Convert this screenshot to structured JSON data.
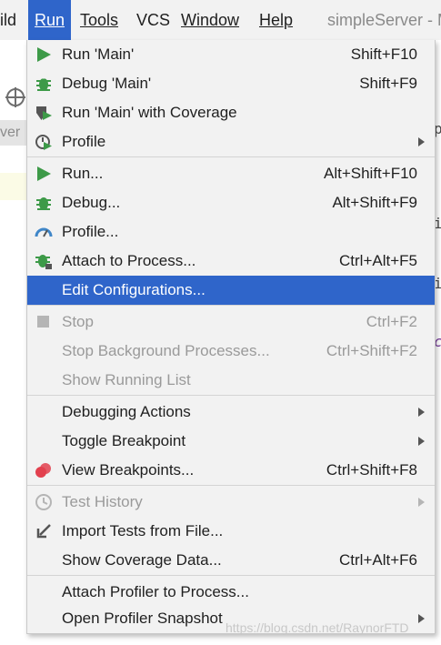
{
  "menubar": {
    "items": [
      {
        "label": "ild"
      },
      {
        "label": "Run"
      },
      {
        "label": "Tools"
      },
      {
        "label": "VCS"
      },
      {
        "label": "Window"
      },
      {
        "label": "Help"
      }
    ],
    "title": "simpleServer - M"
  },
  "background": {
    "side_tab": "ver",
    "right_fragments": [
      "p",
      "i",
      "i",
      "c"
    ]
  },
  "menu": {
    "items": [
      {
        "label": "Run 'Main'",
        "shortcut": "Shift+F10",
        "icon": "run-icon"
      },
      {
        "label": "Debug 'Main'",
        "shortcut": "Shift+F9",
        "icon": "debug-icon"
      },
      {
        "label": "Run 'Main' with Coverage",
        "shortcut": "",
        "icon": "coverage-icon"
      },
      {
        "label": "Profile",
        "shortcut": "",
        "icon": "profile-icon",
        "submenu": true
      },
      {
        "label": "Run...",
        "shortcut": "Alt+Shift+F10",
        "icon": "run-icon"
      },
      {
        "label": "Debug...",
        "shortcut": "Alt+Shift+F9",
        "icon": "debug-icon"
      },
      {
        "label": "Profile...",
        "shortcut": "",
        "icon": "profiler-gauge-icon"
      },
      {
        "label": "Attach to Process...",
        "shortcut": "Ctrl+Alt+F5",
        "icon": "attach-debug-icon"
      },
      {
        "label": "Edit Configurations...",
        "shortcut": "",
        "highlighted": true
      },
      {
        "label": "Stop",
        "shortcut": "Ctrl+F2",
        "icon": "stop-icon",
        "disabled": true
      },
      {
        "label": "Stop Background Processes...",
        "shortcut": "Ctrl+Shift+F2",
        "disabled": true
      },
      {
        "label": "Show Running List",
        "shortcut": "",
        "disabled": true
      },
      {
        "label": "Debugging Actions",
        "shortcut": "",
        "submenu": true
      },
      {
        "label": "Toggle Breakpoint",
        "shortcut": "",
        "submenu": true
      },
      {
        "label": "View Breakpoints...",
        "shortcut": "Ctrl+Shift+F8",
        "icon": "breakpoints-icon"
      },
      {
        "label": "Test History",
        "shortcut": "",
        "icon": "history-icon",
        "disabled": true,
        "submenu": true
      },
      {
        "label": "Import Tests from File...",
        "shortcut": "",
        "icon": "import-icon"
      },
      {
        "label": "Show Coverage Data...",
        "shortcut": "Ctrl+Alt+F6"
      },
      {
        "label": "Attach Profiler to Process...",
        "shortcut": ""
      },
      {
        "label": "Open Profiler Snapshot",
        "shortcut": "",
        "submenu": true
      }
    ]
  },
  "watermark": "https://blog.csdn.net/RaynorFTD",
  "colors": {
    "accent": "#2f65ca",
    "run_green": "#3d9a48",
    "breakpoint_red": "#e2404e"
  }
}
